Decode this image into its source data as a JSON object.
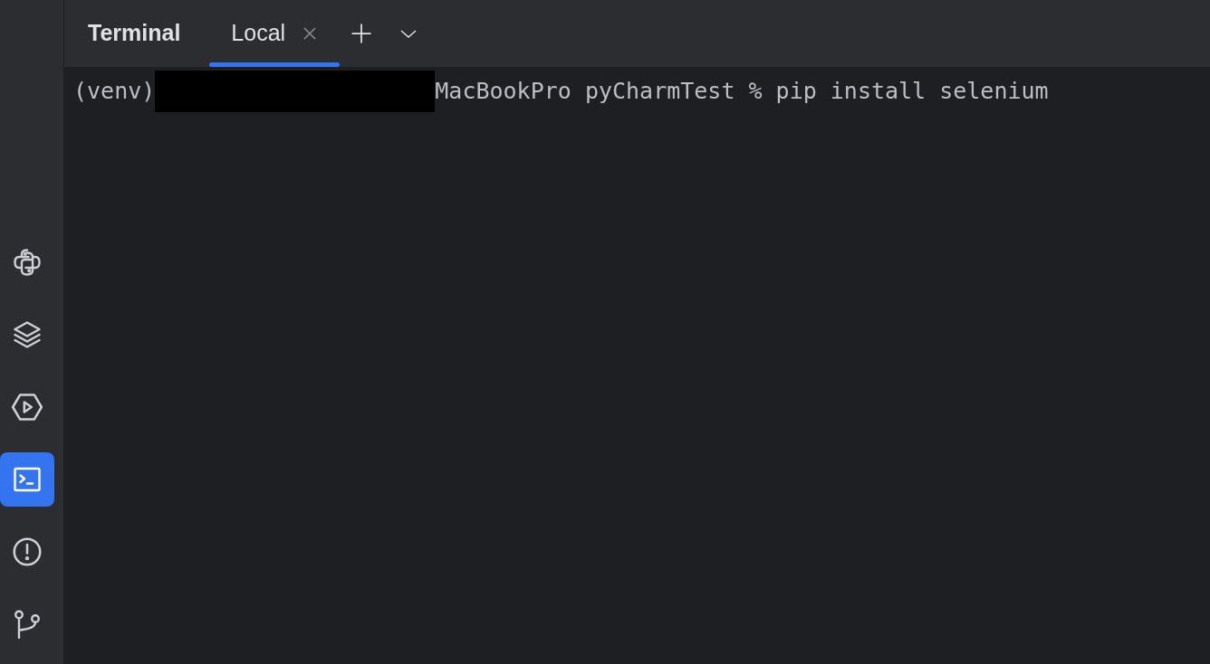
{
  "sidebar": {
    "items": [
      {
        "kind": "python",
        "selected": false
      },
      {
        "kind": "layers",
        "selected": false
      },
      {
        "kind": "run",
        "selected": false
      },
      {
        "kind": "terminal",
        "selected": true
      },
      {
        "kind": "problems",
        "selected": false
      },
      {
        "kind": "git",
        "selected": false
      }
    ]
  },
  "tool_window": {
    "title": "Terminal",
    "tabs": [
      {
        "label": "Local",
        "selected": true,
        "closable": true
      }
    ],
    "actions": [
      {
        "kind": "add"
      },
      {
        "kind": "dropdown"
      }
    ]
  },
  "terminal": {
    "lines": [
      {
        "prefix": "(venv)",
        "redacted": true,
        "text": "MacBookPro pyCharmTest % pip install selenium"
      }
    ]
  }
}
